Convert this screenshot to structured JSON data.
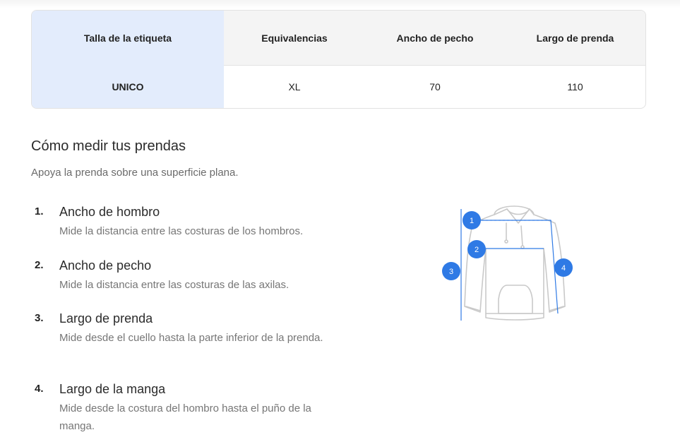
{
  "size_table": {
    "headers": [
      "Talla de la etiqueta",
      "Equivalencias",
      "Ancho de pecho",
      "Largo de prenda"
    ],
    "row": [
      "UNICO",
      "XL",
      "70",
      "110"
    ]
  },
  "guide": {
    "title": "Cómo medir tus prendas",
    "subtitle": "Apoya la prenda sobre una superficie plana.",
    "steps": [
      {
        "number": "1.",
        "title": "Ancho de hombro",
        "description": "Mide la distancia entre las costuras de los hombros."
      },
      {
        "number": "2.",
        "title": "Ancho de pecho",
        "description": "Mide la distancia entre las costuras de las axilas."
      },
      {
        "number": "3.",
        "title": "Largo de prenda",
        "description": "Mide desde el cuello hasta la parte inferior de la prenda."
      },
      {
        "number": "4.",
        "title": "Largo de la manga",
        "description": "Mide desde la costura del hombro hasta el puño de la manga."
      }
    ]
  },
  "diagram": {
    "markers": [
      "1",
      "2",
      "3",
      "4"
    ],
    "accent_color": "#2f7ae5",
    "outline_color": "#c9c9c9"
  }
}
